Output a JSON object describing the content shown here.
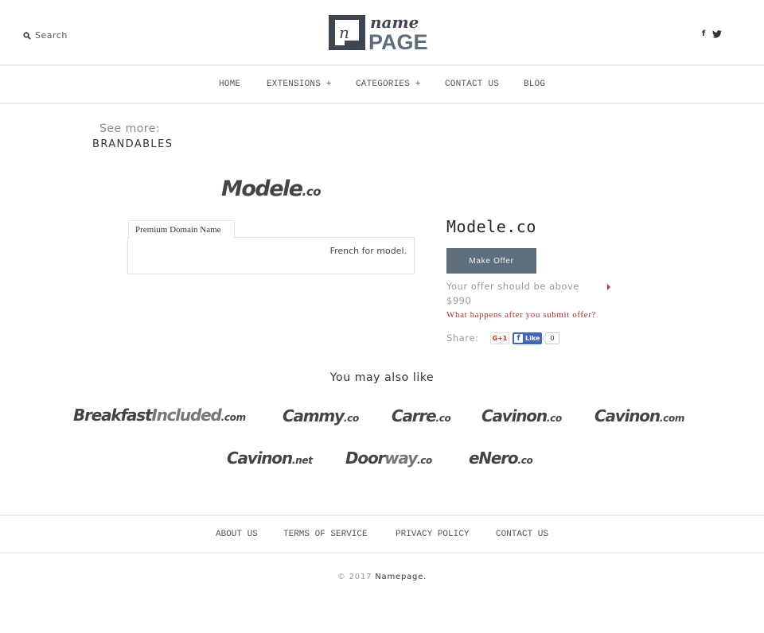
{
  "header": {
    "search_label": "Search",
    "search_icon": "search-icon",
    "logo": {
      "top": "name",
      "bottom": "PAGE",
      "letter": "n"
    },
    "social": [
      {
        "name": "facebook-icon",
        "glyph": "f"
      },
      {
        "name": "twitter-icon",
        "glyph": "🐦"
      }
    ]
  },
  "nav": {
    "items": [
      {
        "label": "HOME"
      },
      {
        "label": "EXTENSIONS +"
      },
      {
        "label": "CATEGORIES +"
      },
      {
        "label": "CONTACT US"
      },
      {
        "label": "BLOG"
      }
    ]
  },
  "see_more": {
    "label": "See more:",
    "link": "BRANDABLES"
  },
  "domain": {
    "logo_name": "Modele",
    "logo_tld": ".co",
    "title": "Modele.co",
    "tab_label": "Premium Domain Name",
    "description": "French for model.",
    "make_offer_label": "Make Offer",
    "offer_note": "Your offer should be above",
    "offer_min": "$990",
    "what_happens": "What happens after you submit offer?",
    "share_label": "Share:",
    "gplus_label": "G+1",
    "fb_like_label": "Like",
    "fb_glyph": "f",
    "fb_count": "0"
  },
  "also_like": {
    "title": "You may also like",
    "items": [
      {
        "name": "Breakfast",
        "light": "Included",
        "tld": ".com"
      },
      {
        "name": "Cammy",
        "light": "",
        "tld": ".co"
      },
      {
        "name": "Carre",
        "light": "",
        "tld": ".co"
      },
      {
        "name": "Cavinon",
        "light": "",
        "tld": ".co"
      },
      {
        "name": "Cavinon",
        "light": "",
        "tld": ".com"
      },
      {
        "name": "Cavinon",
        "light": "",
        "tld": ".net"
      },
      {
        "name": "Door",
        "light": "way",
        "tld": ".co"
      },
      {
        "name": "eNero",
        "light": "",
        "tld": ".co"
      }
    ]
  },
  "footer": {
    "links": [
      {
        "label": "ABOUT US"
      },
      {
        "label": "TERMS OF SERVICE"
      },
      {
        "label": "PRIVACY POLICY"
      },
      {
        "label": "CONTACT US"
      }
    ],
    "copyright_year": "© 2017",
    "copyright_brand": "Namepage."
  }
}
